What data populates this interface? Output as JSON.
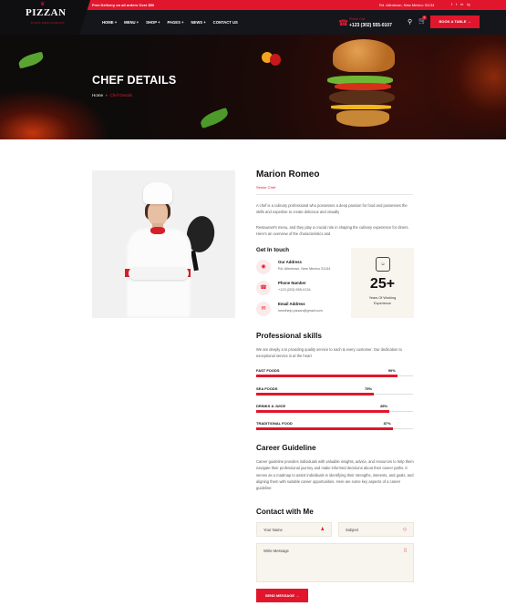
{
  "topbar": {
    "shipping": "Free Delivery on all orders Over $50",
    "address": "Rd. Allentown, New Mexico 31134",
    "social": [
      "f",
      "t",
      "in",
      "ig"
    ]
  },
  "nav": {
    "logo": "PIZZAN",
    "logo_sub": "PIZZA RESTAURANT",
    "menu": [
      "HOME +",
      "MENU +",
      "SHOP +",
      "PAGES +",
      "NEWS +",
      "CONTACT US"
    ],
    "phone_label": "Phone Call",
    "phone": "+123 (302) 555-0107",
    "cart_count": "0",
    "book_button": "BOOK A TABLE →"
  },
  "hero": {
    "title": "CHEF DETAILS",
    "breadcrumb_home": "Home",
    "breadcrumb_sep": "›",
    "breadcrumb_current": "Chef Details"
  },
  "chef": {
    "name": "Marion Romeo",
    "role": "Senior Chef",
    "bio1": "A chef is a culinary professional who possesses a deep passion for food and possesses the skills and expertise to create delicious and visually",
    "bio2": "Restaurant's menu, and they play a crucial role in shaping the culinary experience for diners. Here's an overview of the characteristics and",
    "get_in_touch": "Get In touch",
    "contacts": [
      {
        "title": "Our Address",
        "value": "Rd. Allentown, New Mexico 31134",
        "icon": "location-icon"
      },
      {
        "title": "Phone Number",
        "value": "+123 (203) 555-0134",
        "icon": "phone-icon"
      },
      {
        "title": "Email Address",
        "value": "needhelp.pizzan@gmail.com",
        "icon": "mail-icon"
      }
    ],
    "experience_num": "25+",
    "experience_label": "Years Of Working Experience"
  },
  "skills": {
    "title": "Professional skills",
    "desc": "We are deeply a to providing quality service to each & every customer. Our dedication to exceptional service is at the heart",
    "items": [
      {
        "label": "FAST FOODS",
        "percent": 90,
        "text": "90%"
      },
      {
        "label": "SEA FOODS",
        "percent": 75,
        "text": "75%"
      },
      {
        "label": "DRINKS & JUICE",
        "percent": 85,
        "text": "85%"
      },
      {
        "label": "TRADITIONAL FOOD",
        "percent": 87,
        "text": "87%"
      }
    ]
  },
  "career": {
    "title": "Career Guideline",
    "desc": "Career guideline provides individuals with valuable insights, advice, and resources to help them navigate their professional journey and make informed decisions about their career paths. It serves as a roadmap to assist individuals in identifying their strengths, interests, and goals, and aligning them with suitable career opportunities. Here are some key aspects of a career guideline:"
  },
  "contact_form": {
    "title": "Contact with Me",
    "name_placeholder": "Your Name",
    "subject_placeholder": "Subject",
    "message_placeholder": "Write Message",
    "send_button": "SEND MESSAGE →"
  },
  "colors": {
    "accent": "#e1162d",
    "dark": "#15161b",
    "cream": "#f8f4ee"
  }
}
